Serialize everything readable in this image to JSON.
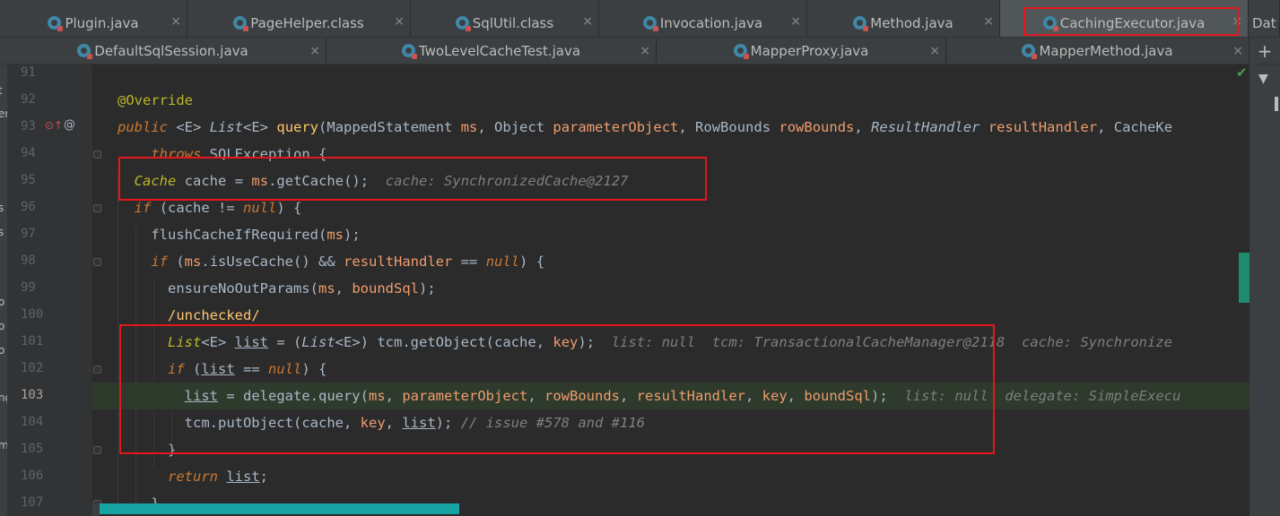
{
  "tabs_row1": [
    {
      "label": "Plugin.java",
      "active": false
    },
    {
      "label": "PageHelper.class",
      "active": false
    },
    {
      "label": "SqlUtil.class",
      "active": false
    },
    {
      "label": "Invocation.java",
      "active": false
    },
    {
      "label": "Method.java",
      "active": false
    },
    {
      "label": "CachingExecutor.java",
      "active": true
    },
    {
      "label": "Dat",
      "active": false
    }
  ],
  "tabs_row2": [
    {
      "label": "DefaultSqlSession.java"
    },
    {
      "label": "TwoLevelCacheTest.java"
    },
    {
      "label": "MapperProxy.java"
    },
    {
      "label": "MapperMethod.java"
    }
  ],
  "close_glyph": "×",
  "line_numbers": [
    "91",
    "92",
    "93",
    "94",
    "95",
    "96",
    "97",
    "98",
    "99",
    "100",
    "101",
    "102",
    "103",
    "104",
    "105",
    "106",
    "107"
  ],
  "current_line": "103",
  "gutter_icons": {
    "override": "⊙↑",
    "at": "@"
  },
  "code": {
    "l92": {
      "annotation": "@Override"
    },
    "l93": {
      "public": "public",
      "e1": "<E>",
      "list": "List",
      "e2": "<E>",
      "name": "query",
      "p1t": "MappedStatement",
      "p1": "ms",
      "p2t": "Object",
      "p2": "parameterObject",
      "p3t": "RowBounds",
      "p3": "rowBounds",
      "p4t": "ResultHandler",
      "p4": "resultHandler",
      "p5t": "CacheKe"
    },
    "l94": {
      "throws": "throws",
      "exc": "SQLException",
      "brace": "{"
    },
    "l95": {
      "type": "Cache",
      "var": "cache",
      "eq": "=",
      "obj": "ms",
      "meth": "getCache",
      "tail": "();",
      "hint": "cache: SynchronizedCache@2127"
    },
    "l96": {
      "if": "if",
      "open": "(cache !=",
      "null": "null",
      "close": ") {"
    },
    "l97": {
      "meth": "flushCacheIfRequired",
      "arg": "ms",
      "tail": ");"
    },
    "l98": {
      "if": "if",
      "obj": "ms",
      "meth": "isUseCache",
      "and": "() &&",
      "rh": "resultHandler",
      "eq": "==",
      "null": "null",
      "close": ") {"
    },
    "l99": {
      "meth": "ensureNoOutParams",
      "a1": "ms",
      "a2": "boundSql",
      "tail": ");"
    },
    "l100": {
      "text": "/unchecked/"
    },
    "l101": {
      "list": "List",
      "e": "<E>",
      "var": "list",
      "eq": "= (",
      "cast": "List",
      "ce": "<E>",
      "obj": ") tcm.",
      "meth": "getObject",
      "a1": "cache",
      "a2": "key",
      "tail": ");",
      "hint1": "list: null",
      "hint2": "tcm: TransactionalCacheManager@2118",
      "hint3": "cache: Synchronize"
    },
    "l102": {
      "if": "if",
      "var": "list",
      "eq": "==",
      "null": "null",
      "close": ") {"
    },
    "l103": {
      "var": "list",
      "eq": "= delegate.",
      "meth": "query",
      "a1": "ms",
      "a2": "parameterObject",
      "a3": "rowBounds",
      "a4": "resultHandler",
      "a5": "key",
      "a6": "boundSql",
      "tail": ");",
      "hint1": "list: null",
      "hint2": "delegate: SimpleExecu"
    },
    "l104": {
      "obj": "tcm.",
      "meth": "putObject",
      "a1": "cache",
      "a2": "key",
      "a3": "list",
      "tail": ");",
      "comment": "// issue #578 and #116"
    },
    "l105": {
      "brace": "}"
    },
    "l106": {
      "ret": "return",
      "var": "list",
      "tail": ";"
    },
    "l107": {
      "brace": "}"
    }
  },
  "right_panel": {
    "plus": "+",
    "arrow": "▼"
  },
  "status_check": "✔",
  "left_strip_chars": [
    "t",
    "er",
    "s",
    "s",
    "o",
    "o",
    "o",
    "ng",
    "m"
  ]
}
